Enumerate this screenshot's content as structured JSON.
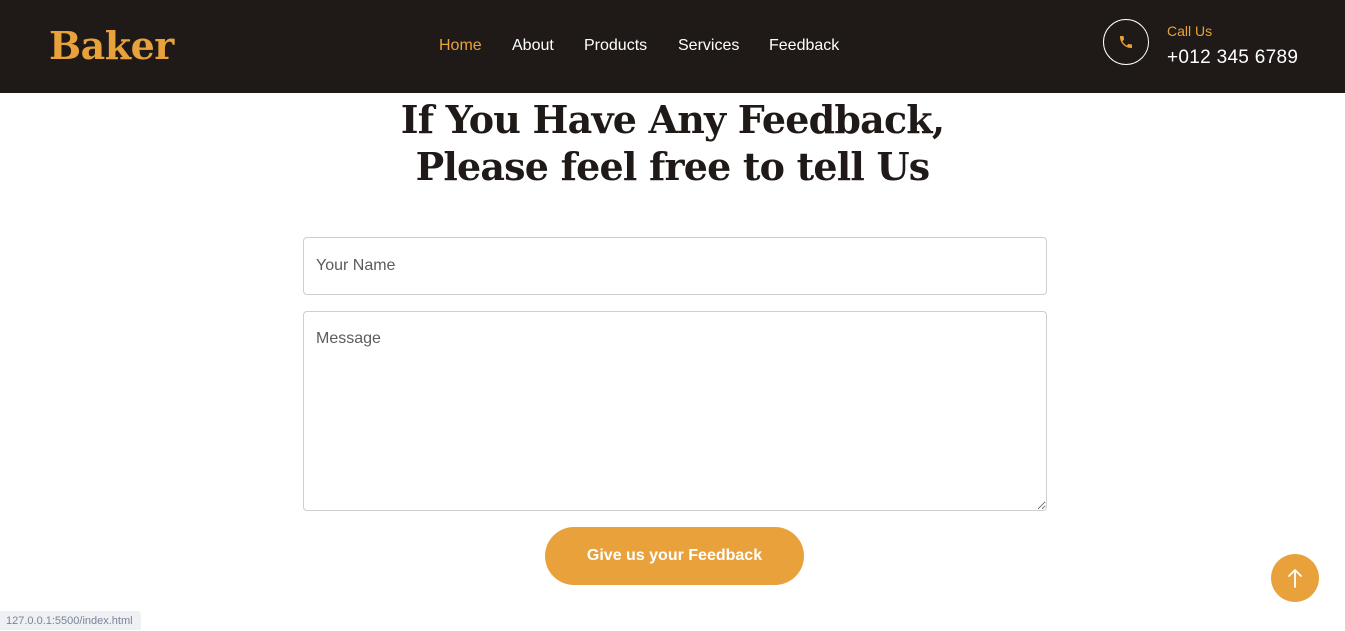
{
  "brand": {
    "logo_text": "Baker",
    "accent_color": "#e9a23b",
    "header_bg_color": "#1f1a17"
  },
  "nav": {
    "items": [
      {
        "label": "Home",
        "active": true
      },
      {
        "label": "About",
        "active": false
      },
      {
        "label": "Products",
        "active": false
      },
      {
        "label": "Services",
        "active": false
      },
      {
        "label": "Feedback",
        "active": false
      }
    ]
  },
  "contact": {
    "icon": "phone-icon",
    "label": "Call Us",
    "number": "+012 345 6789"
  },
  "feedback_section": {
    "heading_line1": "If You Have Any Feedback,",
    "heading_line2": "Please feel free to tell Us",
    "name_placeholder": "Your Name",
    "name_value": "",
    "message_placeholder": "Message",
    "message_value": "",
    "submit_label": "Give us your Feedback"
  },
  "back_to_top": {
    "icon": "arrow-up-icon"
  },
  "status_bar": {
    "url": "127.0.0.1:5500/index.html"
  }
}
